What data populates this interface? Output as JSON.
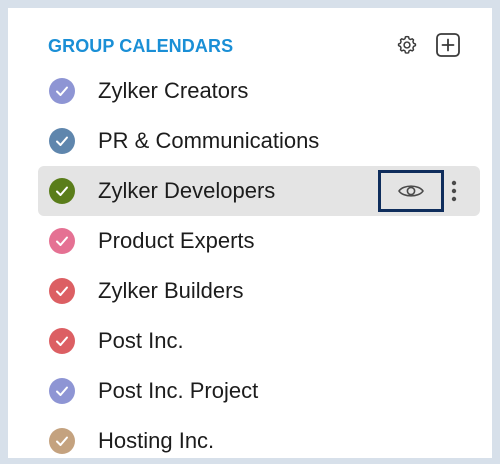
{
  "header": {
    "title": "GROUP CALENDARS",
    "settings_icon": "gear-icon",
    "add_icon": "plus-square-icon"
  },
  "calendars": [
    {
      "label": "Zylker Creators",
      "color": "#8e95d4",
      "checked": true
    },
    {
      "label": "PR & Communications",
      "color": "#5f86ad",
      "checked": true
    },
    {
      "label": "Zylker Developers",
      "color": "#5a7d1a",
      "checked": true,
      "selected": true
    },
    {
      "label": "Product Experts",
      "color": "#e57193",
      "checked": true
    },
    {
      "label": "Zylker Builders",
      "color": "#dc5f63",
      "checked": true
    },
    {
      "label": "Post Inc.",
      "color": "#dc5f63",
      "checked": true
    },
    {
      "label": "Post Inc. Project",
      "color": "#8e95d4",
      "checked": true
    },
    {
      "label": "Hosting Inc.",
      "color": "#c4a27f",
      "checked": true
    }
  ],
  "row_actions": {
    "view_icon": "eye-icon",
    "more_icon": "more-vertical-icon"
  },
  "colors": {
    "accent": "#1a8fd6",
    "highlight_border": "#0f2d5c",
    "selected_row_bg": "#e4e4e4",
    "frame_border": "#d7e0ea"
  }
}
